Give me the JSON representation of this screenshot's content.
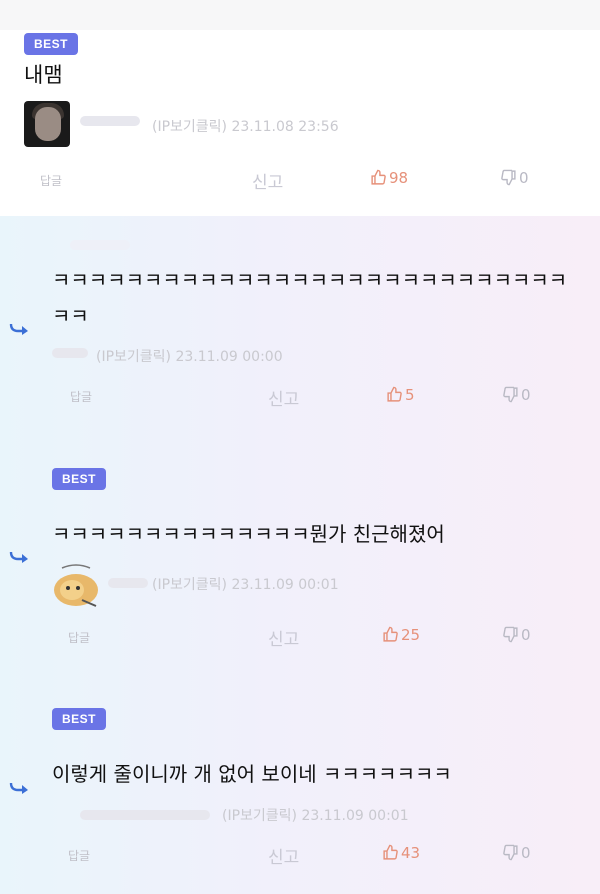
{
  "comments": [
    {
      "best_label": "BEST",
      "text": "내맴",
      "meta": "(IP보기클릭) 23.11.08 23:56",
      "reply_label": "답글",
      "report_label": "신고",
      "likes": "98",
      "dislikes": "0"
    },
    {
      "text_line1": "ㅋㅋㅋㅋㅋㅋㅋㅋㅋㅋㅋㅋㅋㅋㅋㅋㅋㅋㅋㅋㅋㅋㅋㅋㅋㅋㅋㅋ",
      "text_line2": "ㅋㅋ",
      "meta": "(IP보기클릭) 23.11.09 00:00",
      "reply_label": "답글",
      "report_label": "신고",
      "likes": "5",
      "dislikes": "0"
    },
    {
      "best_label": "BEST",
      "text": "ㅋㅋㅋㅋㅋㅋㅋㅋㅋㅋㅋㅋㅋㅋ뭔가 친근해졌어",
      "meta": "(IP보기클릭) 23.11.09 00:01",
      "reply_label": "답글",
      "report_label": "신고",
      "likes": "25",
      "dislikes": "0"
    },
    {
      "best_label": "BEST",
      "text": "이렇게 줄이니까 개 없어 보이네 ㅋㅋㅋㅋㅋㅋㅋ",
      "meta": "(IP보기클릭) 23.11.09 00:01",
      "reply_label": "답글",
      "report_label": "신고",
      "likes": "43",
      "dislikes": "0"
    }
  ],
  "colors": {
    "best_badge": "#6a74e6",
    "like": "#e6917a",
    "reply_arrow": "#3b6fd6"
  }
}
